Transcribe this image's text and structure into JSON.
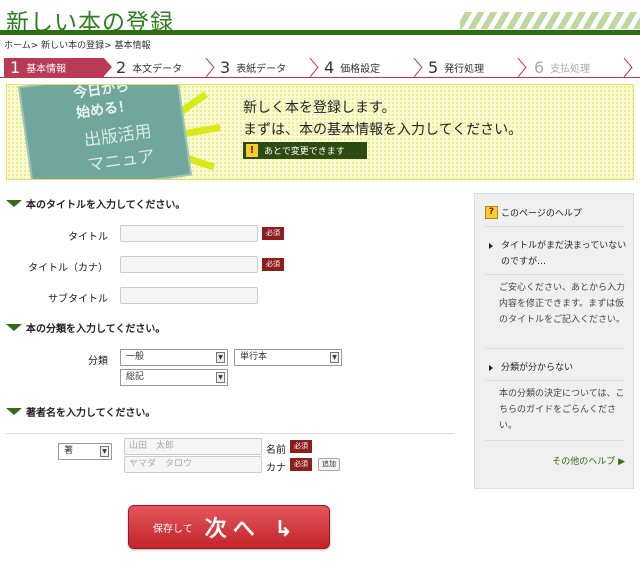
{
  "header": {
    "title": "新しい本の登録",
    "breadcrumb": "ホーム> 新しい本の登録> 基本情報"
  },
  "steps": [
    {
      "num": "1",
      "label": "基本情報",
      "state": "active"
    },
    {
      "num": "2",
      "label": "本文データ",
      "state": "normal"
    },
    {
      "num": "3",
      "label": "表紙データ",
      "state": "normal"
    },
    {
      "num": "4",
      "label": "価格設定",
      "state": "normal"
    },
    {
      "num": "5",
      "label": "発行処理",
      "state": "normal"
    },
    {
      "num": "6",
      "label": "支払処理",
      "state": "disabled"
    }
  ],
  "banner": {
    "line1": "新しく本を登録します。",
    "line2": "まずは、本の基本情報を入力してください。",
    "note": "あとで変更できます",
    "book_text1": "今日から",
    "book_text1b": "始める！",
    "book_text2": "出版活用",
    "book_text2b": "マニュア"
  },
  "title_section": {
    "heading": "本のタイトルを入力してください。",
    "title_label": "タイトル",
    "kana_label": "タイトル（カナ）",
    "subtitle_label": "サブタイトル",
    "required": "必須"
  },
  "category_section": {
    "heading": "本の分類を入力してください。",
    "label": "分類",
    "category_value": "一般",
    "format_value": "単行本",
    "genre_value": "総記"
  },
  "author_section": {
    "heading": "著者名を入力してください。",
    "role_value": "著",
    "name_placeholder": "山田　太郎",
    "kana_placeholder": "ヤマダ　タロウ",
    "name_label": "名前",
    "kana_label": "カナ",
    "required": "必須",
    "add_label": "追加"
  },
  "help": {
    "title": "このページのヘルプ",
    "q1": "タイトルがまだ決まっていないのですが…",
    "a1": "ご安心ください、あとから入力内容を修正できます。まずは仮のタイトルをご記入ください。",
    "q2": "分類が分からない",
    "a2": "本の分類の決定については、こちらのガイドをごらんください。",
    "more": "その他のヘルプ ▶"
  },
  "next_button": {
    "small": "保存して",
    "big": "次へ ↳"
  },
  "colors": {
    "brand_green": "#2e6d12",
    "active_step": "#b83a55",
    "required_badge": "#8d1e1e",
    "next_button": "#d0343a"
  }
}
